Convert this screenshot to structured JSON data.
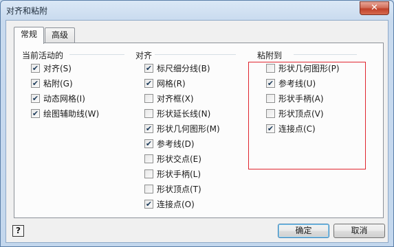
{
  "window": {
    "title": "对齐和粘附",
    "close_symbol": "✕"
  },
  "tabs": [
    {
      "label": "常规",
      "active": true
    },
    {
      "label": "高级",
      "active": false
    }
  ],
  "groups": {
    "current": {
      "title": "当前活动的",
      "items": [
        {
          "label": "对齐(S)",
          "checked": true
        },
        {
          "label": "粘附(G)",
          "checked": true
        },
        {
          "label": "动态网格(I)",
          "checked": true
        },
        {
          "label": "绘图辅助线(W)",
          "checked": true
        }
      ]
    },
    "snap": {
      "title": "对齐",
      "items": [
        {
          "label": "标尺细分线(B)",
          "checked": true
        },
        {
          "label": "网格(R)",
          "checked": true
        },
        {
          "label": "对齐框(X)",
          "checked": false
        },
        {
          "label": "形状延长线(N)",
          "checked": false
        },
        {
          "label": "形状几何图形(M)",
          "checked": true
        },
        {
          "label": "参考线(D)",
          "checked": true
        },
        {
          "label": "形状交点(E)",
          "checked": false
        },
        {
          "label": "形状手柄(L)",
          "checked": false
        },
        {
          "label": "形状顶点(T)",
          "checked": false
        },
        {
          "label": "连接点(O)",
          "checked": true
        }
      ]
    },
    "glue": {
      "title": "粘附到",
      "items": [
        {
          "label": "形状几何图形(P)",
          "checked": false
        },
        {
          "label": "参考线(U)",
          "checked": true
        },
        {
          "label": "形状手柄(A)",
          "checked": false
        },
        {
          "label": "形状顶点(V)",
          "checked": false
        },
        {
          "label": "连接点(C)",
          "checked": true
        }
      ]
    }
  },
  "buttons": {
    "help": "?",
    "ok": "确定",
    "cancel": "取消"
  },
  "colors": {
    "highlight_box": "#e0242d",
    "accent": "#3c7fb1"
  }
}
